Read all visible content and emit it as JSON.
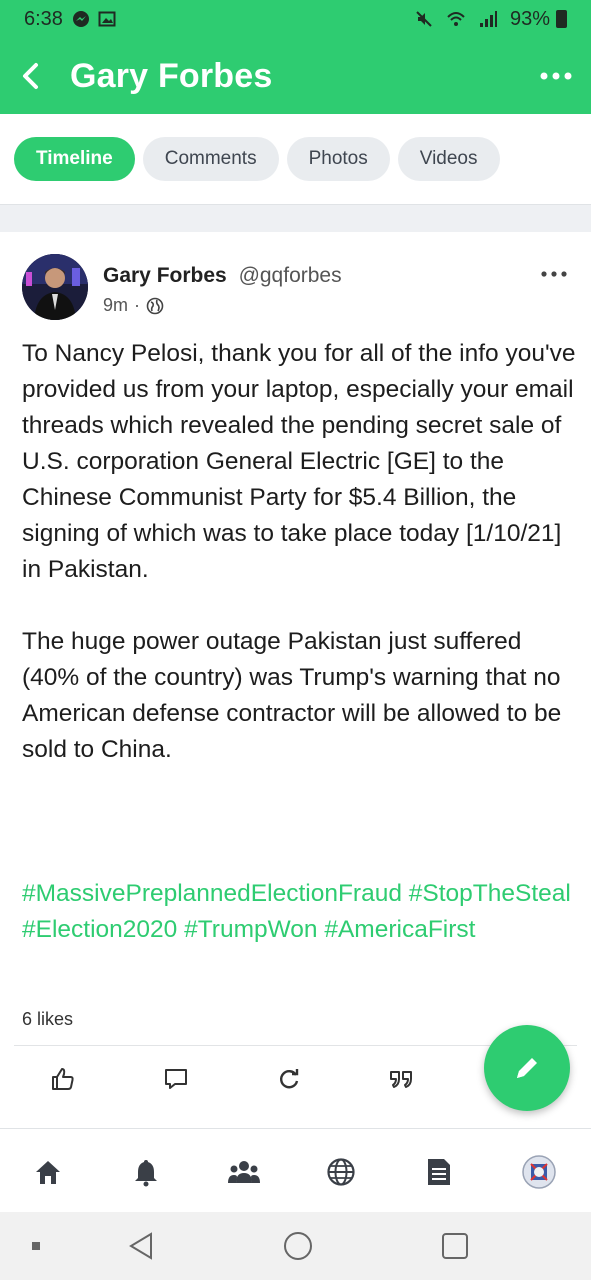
{
  "status_bar": {
    "time": "6:38",
    "battery": "93%"
  },
  "header": {
    "title": "Gary Forbes"
  },
  "tabs": [
    {
      "label": "Timeline",
      "active": true
    },
    {
      "label": "Comments",
      "active": false
    },
    {
      "label": "Photos",
      "active": false
    },
    {
      "label": "Videos",
      "active": false
    }
  ],
  "post": {
    "author_name": "Gary Forbes",
    "handle": "@gqforbes",
    "time": "9m",
    "paragraph1": "To Nancy Pelosi, thank you for all of the info you've provided us from your laptop, especially your email threads which revealed the pending secret sale of U.S. corporation General Electric [GE] to the Chinese Communist Party for $5.4 Billion, the signing of which was to take place today [1/10/21] in Pakistan.",
    "paragraph2": "The huge power outage Pakistan just suffered (40% of the country) was Trump's warning that no American defense contractor will be allowed to be sold to China.",
    "hashtags": "#MassivePreplannedElectionFraud #StopTheSteal #Election2020 #TrumpWon #AmericaFirst",
    "likes": "6 likes"
  },
  "actions": [
    "like-icon",
    "comment-icon",
    "repost-icon",
    "quote-icon"
  ],
  "bottom_nav": [
    "home-icon",
    "bell-icon",
    "groups-icon",
    "globe-icon",
    "document-icon",
    "profile-avatar"
  ],
  "colors": {
    "accent": "#2ecc71",
    "tab_inactive": "#e9ecef"
  }
}
